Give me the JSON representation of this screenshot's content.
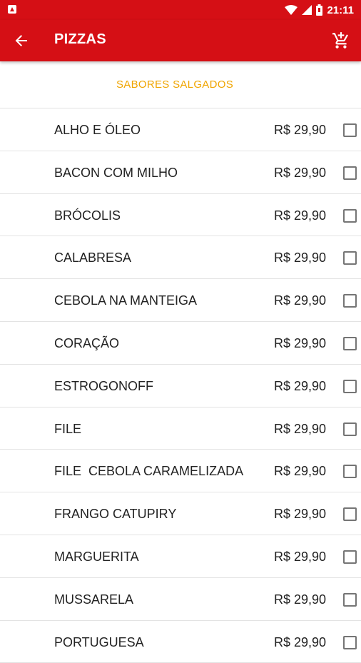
{
  "status_bar": {
    "time": "21:11"
  },
  "app_bar": {
    "title": "PIZZAS"
  },
  "section": {
    "title": "SABORES SALGADOS"
  },
  "items": [
    {
      "name": "ALHO E ÓLEO",
      "price": "R$ 29,90"
    },
    {
      "name": "BACON COM MILHO",
      "price": "R$ 29,90"
    },
    {
      "name": "BRÓCOLIS",
      "price": "R$ 29,90"
    },
    {
      "name": "CALABRESA",
      "price": "R$ 29,90"
    },
    {
      "name": "CEBOLA NA MANTEIGA",
      "price": "R$ 29,90"
    },
    {
      "name": "CORAÇÃO",
      "price": "R$ 29,90"
    },
    {
      "name": "ESTROGONOFF",
      "price": "R$ 29,90"
    },
    {
      "name": "FILE",
      "price": "R$ 29,90"
    },
    {
      "name": "FILE  CEBOLA CARAMELIZADA",
      "price": "R$ 29,90"
    },
    {
      "name": "FRANGO CATUPIRY",
      "price": "R$ 29,90"
    },
    {
      "name": "MARGUERITA",
      "price": "R$ 29,90"
    },
    {
      "name": "MUSSARELA",
      "price": "R$ 29,90"
    },
    {
      "name": "PORTUGUESA",
      "price": "R$ 29,90"
    }
  ],
  "colors": {
    "brand": "#d50f15",
    "section_title": "#f0a500"
  },
  "icons": {
    "back": "arrow-back-icon",
    "cart": "add-to-cart-icon",
    "wifi": "wifi-icon",
    "signal": "signal-icon",
    "battery": "battery-icon",
    "notification": "app-notification-icon"
  }
}
